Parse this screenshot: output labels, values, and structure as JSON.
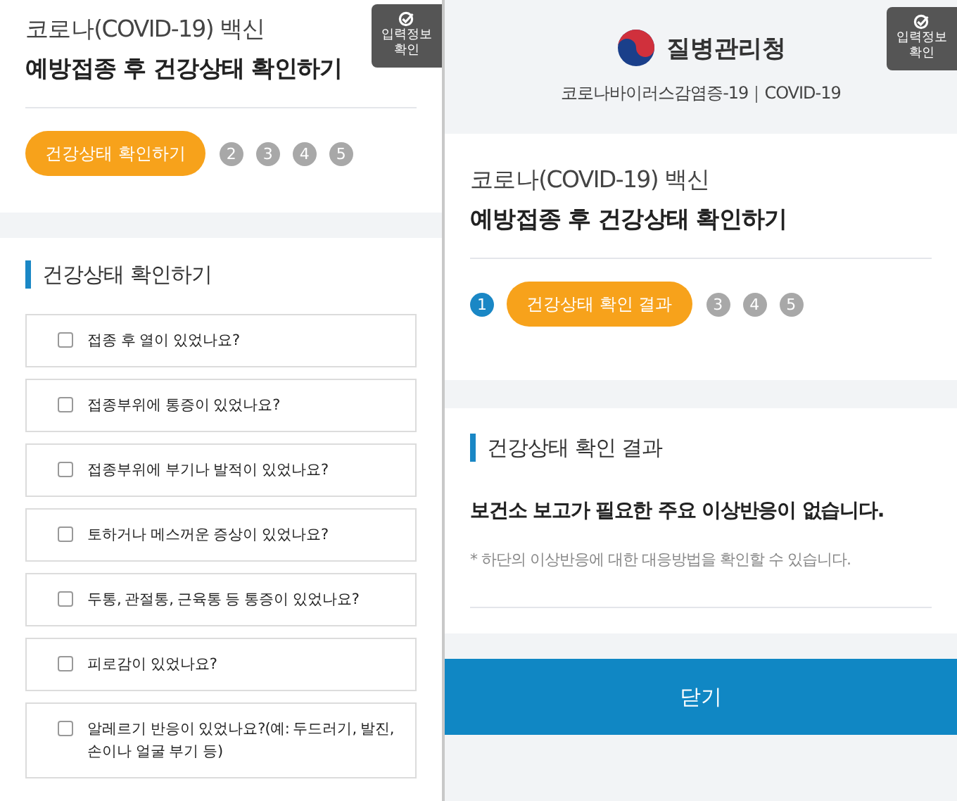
{
  "left_screen": {
    "info_button": "입력정보 확인",
    "title_line_1": "코로나(COVID-19) 백신",
    "title_line_2": "예방접종 후 건강상태 확인하기",
    "steps": [
      {
        "label": "건강상태 확인하기",
        "selected": true,
        "done": false
      },
      {
        "label": "2",
        "selected": false,
        "done": false
      },
      {
        "label": "3",
        "selected": false,
        "done": false
      },
      {
        "label": "4",
        "selected": false,
        "done": false
      },
      {
        "label": "5",
        "selected": false,
        "done": false
      }
    ],
    "section_heading": "건강상태 확인하기",
    "questions": [
      {
        "label": "접종 후 열이 있었나요?",
        "checked": false
      },
      {
        "label": "접종부위에 통증이 있었나요?",
        "checked": false
      },
      {
        "label": "접종부위에 부기나 발적이 있었나요?",
        "checked": false
      },
      {
        "label": "토하거나 메스꺼운 증상이 있었나요?",
        "checked": false
      },
      {
        "label": "두통, 관절통, 근육통 등 통증이 있었나요?",
        "checked": false
      },
      {
        "label": "피로감이 있었나요?",
        "checked": false
      },
      {
        "label": "알레르기 반응이 있었나요?(예: 두드러기, 발진, 손이나 얼굴 부기 등)",
        "checked": false
      }
    ]
  },
  "right_screen": {
    "agency": "질병관리청",
    "subtitle": "코로나바이러스감염증-19｜COVID-19",
    "info_button": "입력정보 확인",
    "title_line_1": "코로나(COVID-19) 백신",
    "title_line_2": "예방접종 후 건강상태 확인하기",
    "steps": [
      {
        "label": "1",
        "selected": false,
        "done": true
      },
      {
        "label": "건강상태 확인 결과",
        "selected": true,
        "done": false
      },
      {
        "label": "3",
        "selected": false,
        "done": false
      },
      {
        "label": "4",
        "selected": false,
        "done": false
      },
      {
        "label": "5",
        "selected": false,
        "done": false
      }
    ],
    "section_heading": "건강상태 확인 결과",
    "result": "보건소 보고가 필요한 주요 이상반응이 없습니다.",
    "note": "* 하단의 이상반응에 대한 대응방법을 확인할 수 있습니다.",
    "close_button": "닫기"
  }
}
